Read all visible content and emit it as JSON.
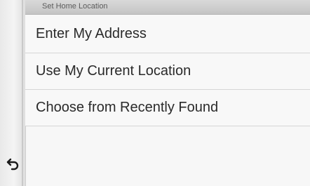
{
  "screen": {
    "title": "Set Home Location"
  },
  "menu": {
    "items": [
      {
        "label": "Enter My Address"
      },
      {
        "label": "Use My Current Location"
      },
      {
        "label": "Choose from Recently Found"
      }
    ]
  },
  "icons": {
    "back": "back-arrow-icon"
  },
  "colors": {
    "title_bar": "#c4c4c4",
    "list_background": "#f8f8f8",
    "text": "#2a2a2a"
  }
}
